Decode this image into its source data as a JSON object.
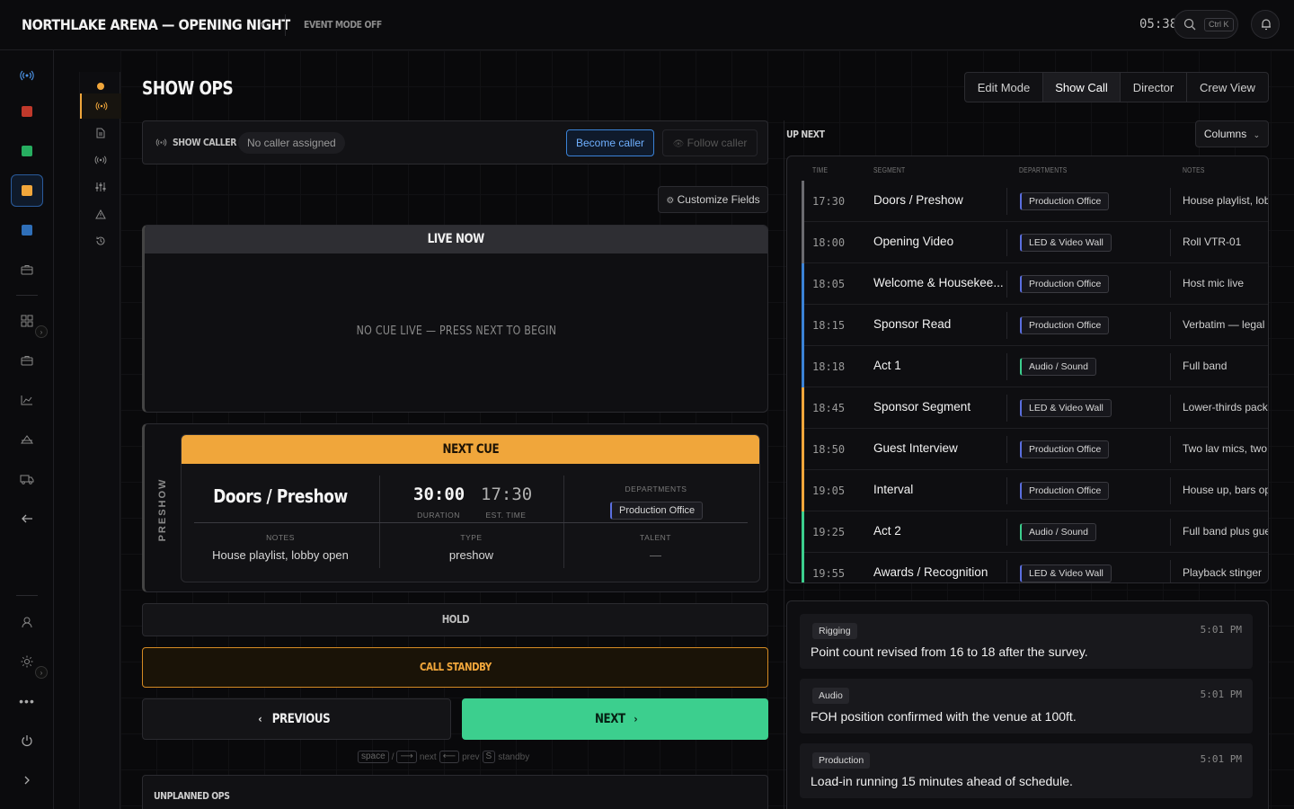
{
  "app": {
    "title": "NORTHLAKE ARENA — OPENING NIGHT",
    "event_mode": "EVENT MODE OFF",
    "clock": "05:38",
    "search_shortcut": "Ctrl K"
  },
  "page": {
    "title": "SHOW OPS"
  },
  "view_tabs": [
    {
      "label": "Edit Mode"
    },
    {
      "label": "Show Call"
    },
    {
      "label": "Director"
    },
    {
      "label": "Crew View"
    }
  ],
  "active_view": "Show Call",
  "caller": {
    "label": "SHOW CALLER",
    "status": "No caller assigned",
    "become": "Become caller",
    "follow": "Follow caller"
  },
  "customize": "Customize Fields",
  "live": {
    "header": "LIVE NOW",
    "empty": "NO CUE LIVE — PRESS NEXT TO BEGIN"
  },
  "next_cue": {
    "header": "NEXT CUE",
    "phase": "PRESHOW",
    "name": "Doors / Preshow",
    "duration": "30:00",
    "duration_label": "DURATION",
    "est_time": "17:30",
    "est_time_label": "EST. TIME",
    "departments_label": "DEPARTMENTS",
    "department": "Production Office",
    "notes_label": "NOTES",
    "notes": "House playlist, lobby open",
    "type_label": "TYPE",
    "type": "preshow",
    "talent_label": "TALENT",
    "talent": "—"
  },
  "controls": {
    "hold": "HOLD",
    "standby": "CALL STANDBY",
    "previous": "PREVIOUS",
    "next": "NEXT",
    "hint_space": "space",
    "hint_slash": "/",
    "hint_next": "next",
    "hint_prev": "prev",
    "hint_s": "S",
    "hint_standby": "standby"
  },
  "unplanned": {
    "title": "UNPLANNED OPS"
  },
  "upnext": {
    "title": "UP NEXT",
    "columns_btn": "Columns",
    "headers": {
      "time": "TIME",
      "segment": "SEGMENT",
      "departments": "DEPARTMENTS",
      "notes": "NOTES"
    },
    "rows": [
      {
        "time": "17:30",
        "segment": "Doors / Preshow",
        "dept": "Production Office",
        "note": "House playlist, lob",
        "color": "#6b6b70"
      },
      {
        "time": "18:00",
        "segment": "Opening Video",
        "dept": "LED & Video Wall",
        "note": "Roll VTR-01",
        "color": "#6b6b70"
      },
      {
        "time": "18:05",
        "segment": "Welcome & Housekee...",
        "dept": "Production Office",
        "note": "Host mic live",
        "color": "#3b82d6"
      },
      {
        "time": "18:15",
        "segment": "Sponsor Read",
        "dept": "Production Office",
        "note": "Verbatim — legal",
        "color": "#3b82d6"
      },
      {
        "time": "18:18",
        "segment": "Act 1",
        "dept": "Audio / Sound",
        "note": "Full band",
        "color": "#3b82d6"
      },
      {
        "time": "18:45",
        "segment": "Sponsor Segment",
        "dept": "LED & Video Wall",
        "note": "Lower-thirds pack",
        "color": "#f0a63b"
      },
      {
        "time": "18:50",
        "segment": "Guest Interview",
        "dept": "Production Office",
        "note": "Two lav mics, two",
        "color": "#f0a63b"
      },
      {
        "time": "19:05",
        "segment": "Interval",
        "dept": "Production Office",
        "note": "House up, bars op",
        "color": "#f0a63b"
      },
      {
        "time": "19:25",
        "segment": "Act 2",
        "dept": "Audio / Sound",
        "note": "Full band plus gue",
        "color": "#3ccf8e"
      },
      {
        "time": "19:55",
        "segment": "Awards / Recognition",
        "dept": "LED & Video Wall",
        "note": "Playback stinger",
        "color": "#3ccf8e"
      }
    ]
  },
  "updates": [
    {
      "tag": "Rigging",
      "time": "5:01 PM",
      "text": "Point count revised from 16 to 18 after the survey."
    },
    {
      "tag": "Audio",
      "time": "5:01 PM",
      "text": "FOH position confirmed with the venue at 100ft."
    },
    {
      "tag": "Production",
      "time": "5:01 PM",
      "text": "Load-in running 15 minutes ahead of schedule."
    }
  ],
  "colors": {
    "accent": "#f0a63b",
    "next": "#3ccf8e",
    "caller": "#3b82d6"
  }
}
